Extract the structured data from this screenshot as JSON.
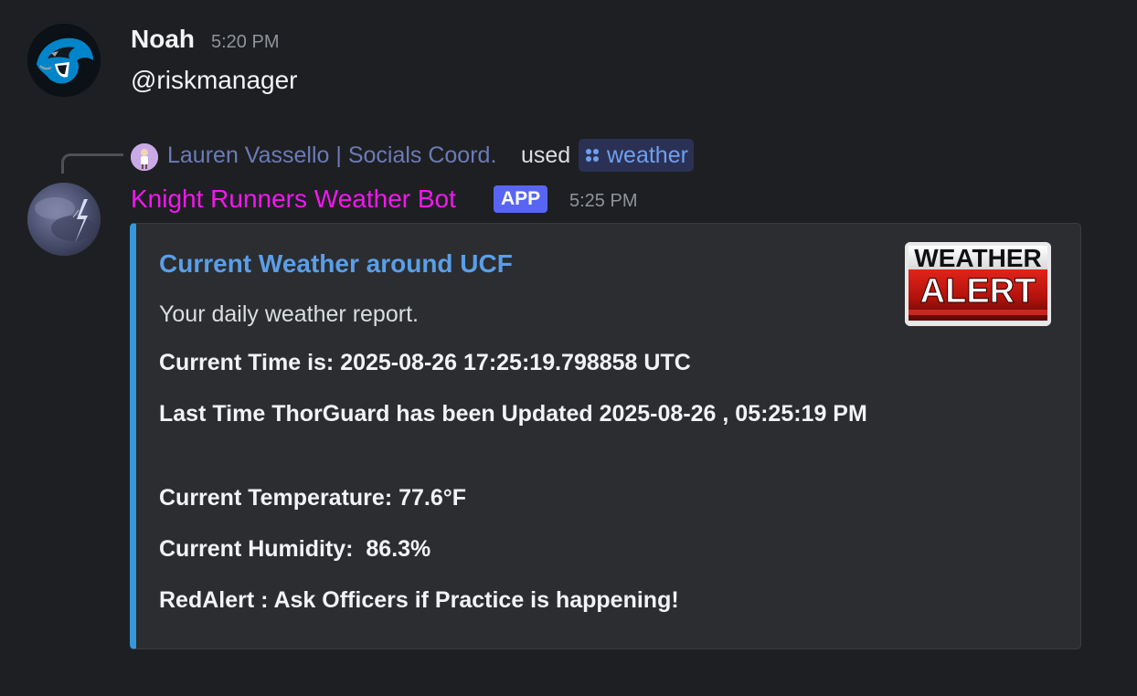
{
  "messages": [
    {
      "author": "Noah",
      "time": "5:20 PM",
      "content": "@riskmanager",
      "avatar_icon": "panther-logo-icon"
    }
  ],
  "command_reply": {
    "invoker": "Lauren Vassello | Socials Coord.",
    "used_label": "used",
    "command": "weather",
    "command_icon": "slash-command-icon"
  },
  "bot_message": {
    "author": "Knight Runners Weather Bot",
    "badge": "APP",
    "time": "5:25 PM",
    "author_color": "#f217f0",
    "avatar_icon": "lightning-storm-icon",
    "embed": {
      "accent_color": "#3498db",
      "title": "Current Weather around UCF",
      "description": "Your daily weather report.",
      "fields": {
        "current_time": "Current Time is: 2025-08-26 17:25:19.798858 UTC",
        "last_updated": "Last Time ThorGuard has been Updated 2025-08-26 , 05:25:19 PM",
        "temperature": "Current Temperature: 77.6°F",
        "humidity": "Current Humidity:  86.3%",
        "red_alert": "RedAlert : Ask Officers if Practice is happening!"
      },
      "thumbnail": {
        "line1": "WEATHER",
        "line2": "ALERT"
      }
    }
  }
}
